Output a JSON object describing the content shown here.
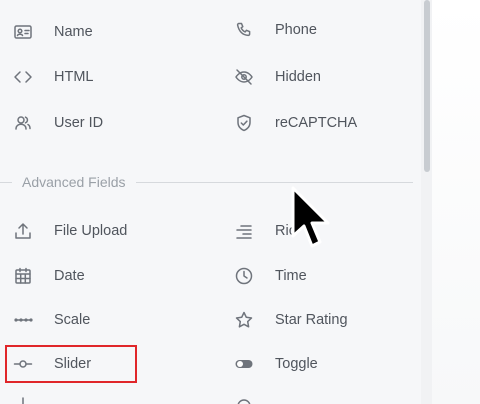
{
  "basic_fields": [
    {
      "label": "Name",
      "icon": "id-card-icon"
    },
    {
      "label": "Phone",
      "icon": "phone-icon"
    },
    {
      "label": "HTML",
      "icon": "code-brackets-icon"
    },
    {
      "label": "Hidden",
      "icon": "eye-slash-icon"
    },
    {
      "label": "User ID",
      "icon": "users-icon"
    },
    {
      "label": "reCAPTCHA",
      "icon": "shield-check-icon"
    }
  ],
  "section": {
    "title": "Advanced Fields"
  },
  "advanced_fields": [
    {
      "label": "File Upload",
      "icon": "upload-icon"
    },
    {
      "label": "Ric",
      "icon": "align-right-icon"
    },
    {
      "label": "Date",
      "icon": "calendar-icon"
    },
    {
      "label": "Time",
      "icon": "clock-icon"
    },
    {
      "label": "Scale",
      "icon": "dots-scale-icon"
    },
    {
      "label": "Star Rating",
      "icon": "star-icon"
    },
    {
      "label": "Slider",
      "icon": "slider-icon"
    },
    {
      "label": "Toggle",
      "icon": "toggle-icon"
    }
  ],
  "highlight_color": "#e0262a"
}
